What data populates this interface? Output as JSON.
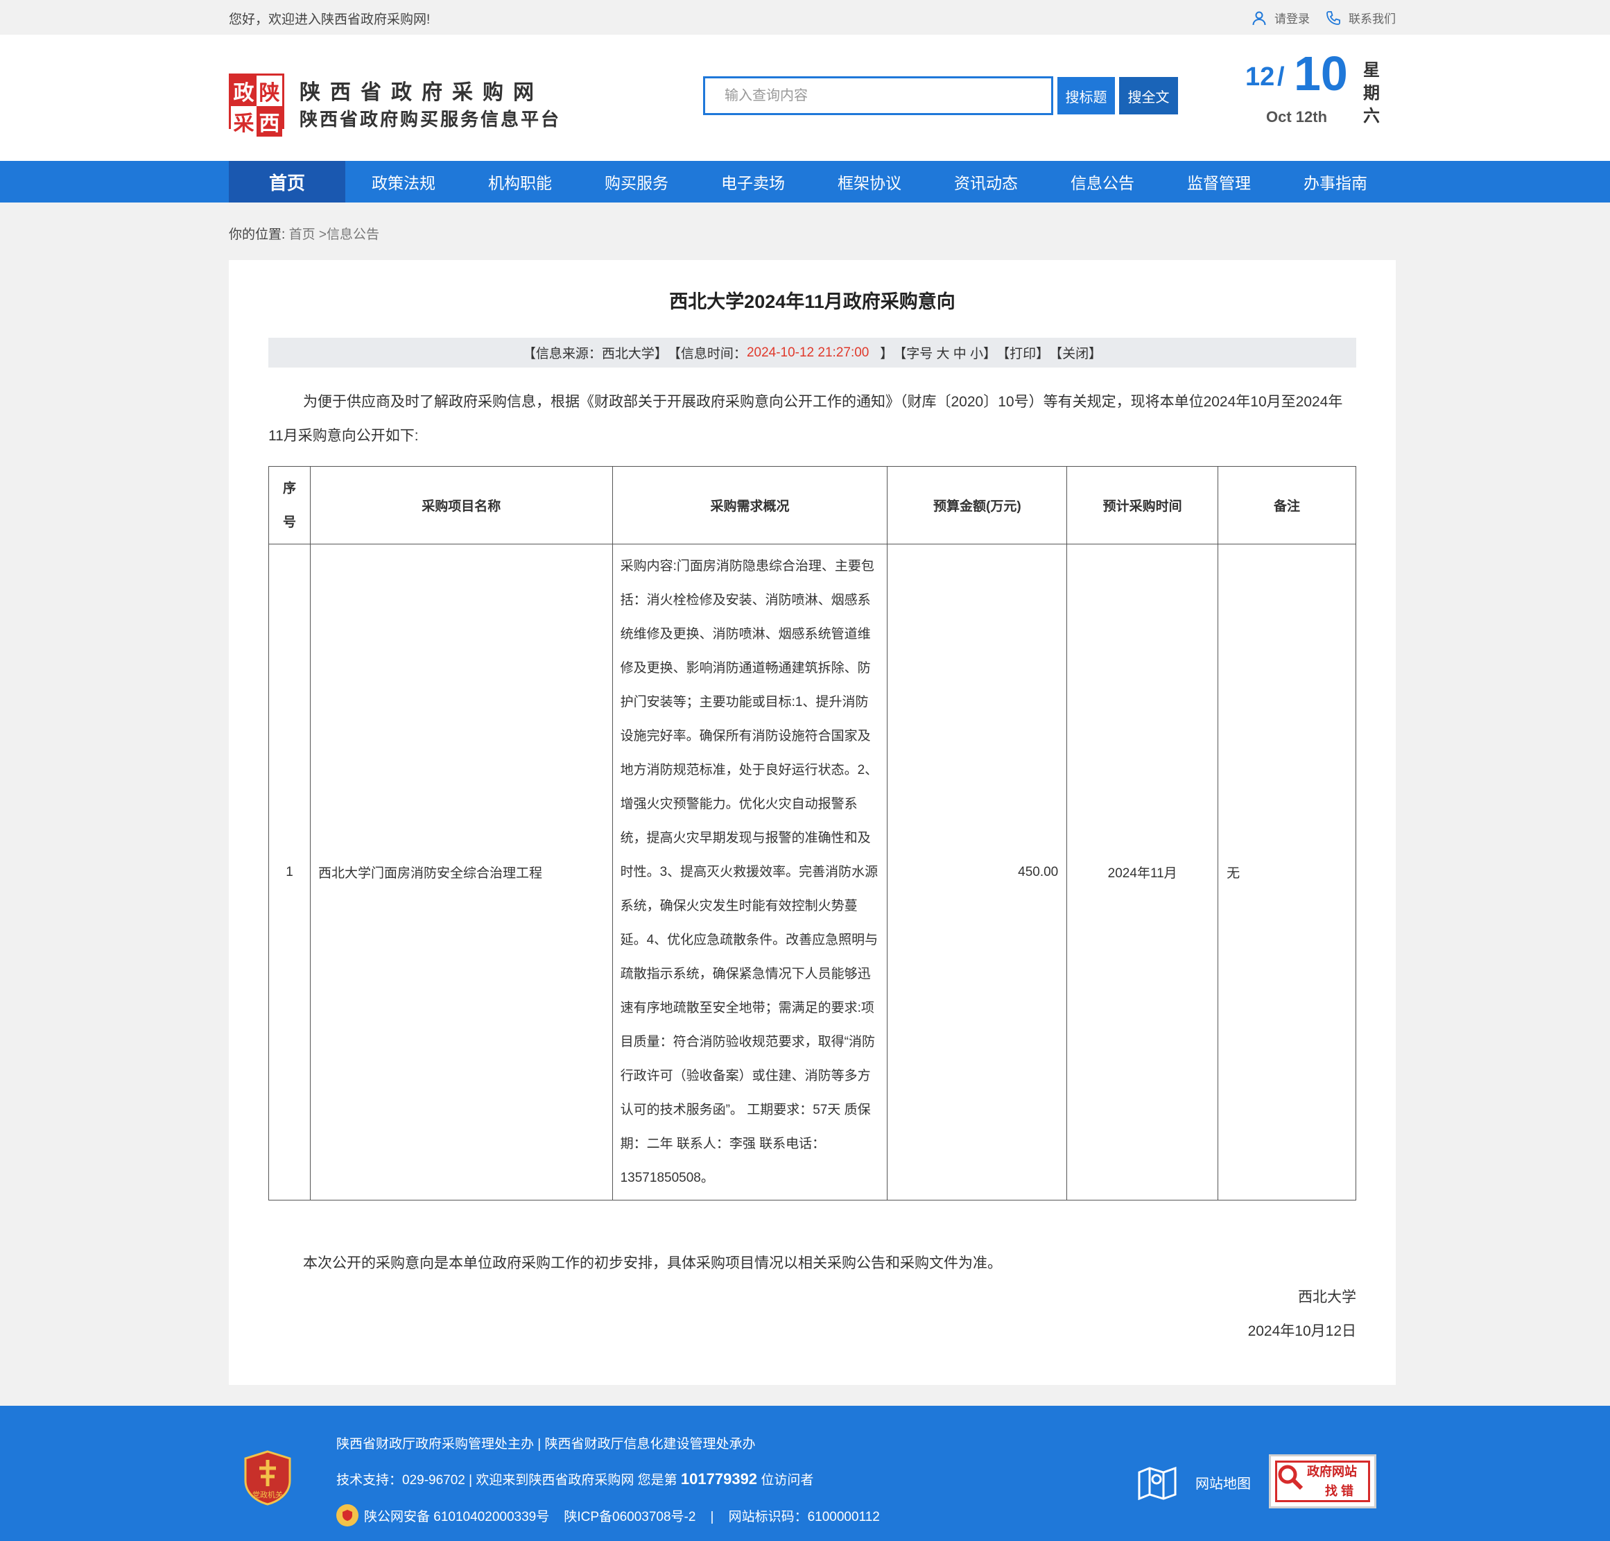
{
  "topbar": {
    "welcome": "您好，欢迎进入陕西省政府采购网!",
    "login": "请登录",
    "contact": "联系我们"
  },
  "header": {
    "logo_chars": [
      "政",
      "陕",
      "采",
      "西"
    ],
    "site_name": "陕西省政府采购网",
    "site_sub": "陕西省政府购买服务信息平台",
    "search_placeholder": "输入查询内容",
    "btn_title": "搜标题",
    "btn_full": "搜全文",
    "date_month": "12",
    "date_slash": "/",
    "date_day": "10",
    "date_en": "Oct 12th",
    "date_week": [
      "星",
      "期",
      "六"
    ]
  },
  "nav": [
    "首页",
    "政策法规",
    "机构职能",
    "购买服务",
    "电子卖场",
    "框架协议",
    "资讯动态",
    "信息公告",
    "监督管理",
    "办事指南"
  ],
  "breadcrumb": {
    "label": "你的位置:",
    "home": "首页",
    "current": " >信息公告"
  },
  "article": {
    "title": "西北大学2024年11月政府采购意向",
    "info": {
      "source": "【信息来源：西北大学】",
      "time_label": "【信息时间：",
      "time_value": "2024-10-12 21:27:00",
      "time_end": "   】",
      "font": "【字号 大 中 小】",
      "print": "【打印】",
      "close": "【关闭】"
    },
    "intro": "为便于供应商及时了解政府采购信息，根据《财政部关于开展政府采购意向公开工作的通知》（财库〔2020〕10号）等有关规定，现将本单位2024年10月至2024年11月采购意向公开如下:",
    "table": {
      "headers": [
        "序号",
        "采购项目名称",
        "采购需求概况",
        "预算金额(万元)",
        "预计采购时间",
        "备注"
      ],
      "rows": [
        {
          "seq": "1",
          "name": "西北大学门面房消防安全综合治理工程",
          "desc": "采购内容:门面房消防隐患综合治理、主要包括：消火栓检修及安装、消防喷淋、烟感系统维修及更换、消防喷淋、烟感系统管道维修及更换、影响消防通道畅通建筑拆除、防护门安装等；主要功能或目标:1、提升消防设施完好率。确保所有消防设施符合国家及地方消防规范标准，处于良好运行状态。2、增强火灾预警能力。优化火灾自动报警系统，提高火灾早期发现与报警的准确性和及时性。3、提高灭火救援效率。完善消防水源系统，确保火灾发生时能有效控制火势蔓延。4、优化应急疏散条件。改善应急照明与疏散指示系统，确保紧急情况下人员能够迅速有序地疏散至安全地带；需满足的要求:项目质量：符合消防验收规范要求，取得“消防行政许可（验收备案）或住建、消防等多方认可的技术服务函”。 工期要求：57天 质保期：二年 联系人：李强 联系电话：13571850508。",
          "budget": "450.00",
          "time": "2024年11月",
          "note": "无"
        }
      ]
    },
    "note": "本次公开的采购意向是本单位政府采购工作的初步安排，具体采购项目情况以相关采购公告和采购文件为准。",
    "signer": "西北大学",
    "sign_date": "2024年10月12日"
  },
  "footer": {
    "badge_text": "党政机关",
    "line1": "陕西省财政厅政府采购管理处主办 | 陕西省财政厅信息化建设管理处承办",
    "line2_pre": "技术支持：029-96702 | 欢迎来到陕西省政府采购网 您是第 ",
    "visitors": "101779392",
    "line2_post": " 位访问者",
    "line3": "陕公网安备 61010402000339号    陕ICP备06003708号-2    |    网站标识码：6100000112",
    "sitemap": "网站地图",
    "err_t1": "政府网站",
    "err_t2": "找 错"
  },
  "colors": {
    "primary": "#1f78d9",
    "nav_active": "#1a58b0",
    "logo_red": "#d62b2b",
    "time_red": "#e0392b"
  }
}
